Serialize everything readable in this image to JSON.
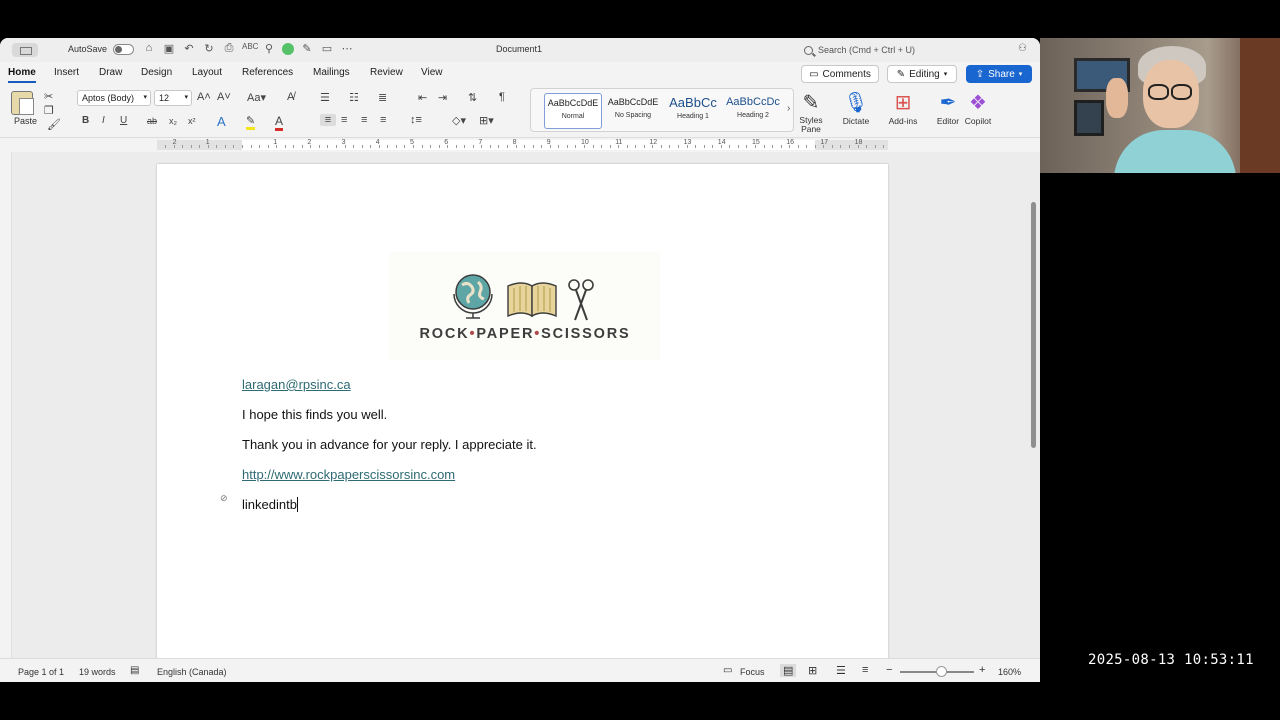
{
  "titlebar": {
    "autosave_label": "AutoSave",
    "doc_title": "Document1",
    "search_placeholder": "Search (Cmd + Ctrl + U)"
  },
  "tabs": [
    "Home",
    "Insert",
    "Draw",
    "Design",
    "Layout",
    "References",
    "Mailings",
    "Review",
    "View"
  ],
  "active_tab": "Home",
  "actions": {
    "comments": "Comments",
    "editing": "Editing",
    "share": "Share"
  },
  "ribbon": {
    "paste_label": "Paste",
    "font_name": "Aptos (Body)",
    "font_size": "12",
    "styles": [
      {
        "sample": "AaBbCcDdE",
        "name": "Normal"
      },
      {
        "sample": "AaBbCcDdE",
        "name": "No Spacing"
      },
      {
        "sample": "AaBbCc",
        "name": "Heading 1"
      },
      {
        "sample": "AaBbCcDc",
        "name": "Heading 2"
      }
    ],
    "styles_pane_label_1": "Styles",
    "styles_pane_label_2": "Pane",
    "dictate_label": "Dictate",
    "addins_label": "Add-ins",
    "editor_label": "Editor",
    "copilot_label": "Copilot",
    "bold": "B",
    "italic": "I",
    "underline": "U",
    "strike": "ab",
    "subscript": "x₂",
    "superscript": "x²"
  },
  "ruler_numbers": [
    "2",
    "1",
    "1",
    "2",
    "3",
    "4",
    "5",
    "6",
    "7",
    "8",
    "9",
    "10",
    "11",
    "12",
    "13",
    "14",
    "15",
    "16",
    "17",
    "18"
  ],
  "document": {
    "logo_text_parts": [
      "ROCK",
      "PAPER",
      "SCISSORS"
    ],
    "email": "laragan@rpsinc.ca",
    "line1": "I hope this finds you well.",
    "line2": "Thank you in advance for your reply.  I appreciate it.",
    "website": "http://www.rockpaperscissorsinc.com",
    "typing": "linkedintb"
  },
  "statusbar": {
    "page": "Page 1 of 1",
    "words": "19 words",
    "language": "English (Canada)",
    "focus": "Focus",
    "zoom": "160%"
  },
  "overlay": {
    "timestamp": "2025-08-13  10:53:11"
  },
  "colors": {
    "accent_blue": "#1a66d1",
    "link_teal": "#2e6b73",
    "logo_dot_red": "#b04a4a"
  }
}
